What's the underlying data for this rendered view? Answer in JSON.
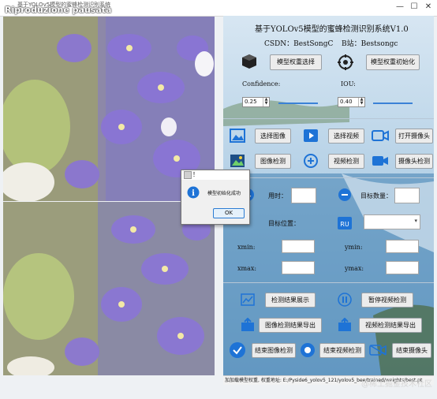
{
  "window": {
    "title": "基于YOLOv5模型的蜜蜂检测识别系统",
    "video_overlay": "Riproduzione pausata",
    "min": "—",
    "max": "☐",
    "close": "✕"
  },
  "panel": {
    "heading": "基于YOLOv5模型的蜜蜂检测识别系统V1.0",
    "csdn": "CSDN：BestSongC",
    "bilibili": "B站：Bestsongc",
    "buttons": {
      "select_model": "模型权重选择",
      "init_model": "模型权重初始化",
      "select_image": "选择图像",
      "select_video": "选择视频",
      "open_camera": "打开摄像头",
      "image_detect": "图像检测",
      "video_detect": "视频检测",
      "camera_detect": "摄像头检测",
      "show_results": "检测结果展示",
      "pause_video": "暂停视频检测",
      "export_image": "图像检测结果导出",
      "export_video": "视频检测结果导出",
      "end_image": "结束图像检测",
      "end_video": "结束视频检测",
      "end_camera": "结束摄像头"
    },
    "confidence_label": "Confidence:",
    "confidence_value": "0.25",
    "confidence_fraction": 0.25,
    "iou_label": "IOU:",
    "iou_value": "0.40",
    "iou_fraction": 0.4,
    "time_label": "用时：",
    "target_count_label": "目标数量：",
    "target_pos_label": "目标位置：",
    "xmin": "xmin:",
    "ymin": "ymin:",
    "xmax": "xmax:",
    "ymax": "ymax:"
  },
  "dialog": {
    "title": "！",
    "message": "模型初始化成功",
    "ok": "OK"
  },
  "statusbar": {
    "text": "加加载模型权重, 权重地址: E:/Pyside6_yolov5_121/yolov5_bee/trained/weights/best.pt"
  },
  "watermark": "@稀土掘金技术社区",
  "colors": {
    "accent": "#1e73d6",
    "slider": "#3b82d6",
    "sea": "#3f7fb0"
  }
}
